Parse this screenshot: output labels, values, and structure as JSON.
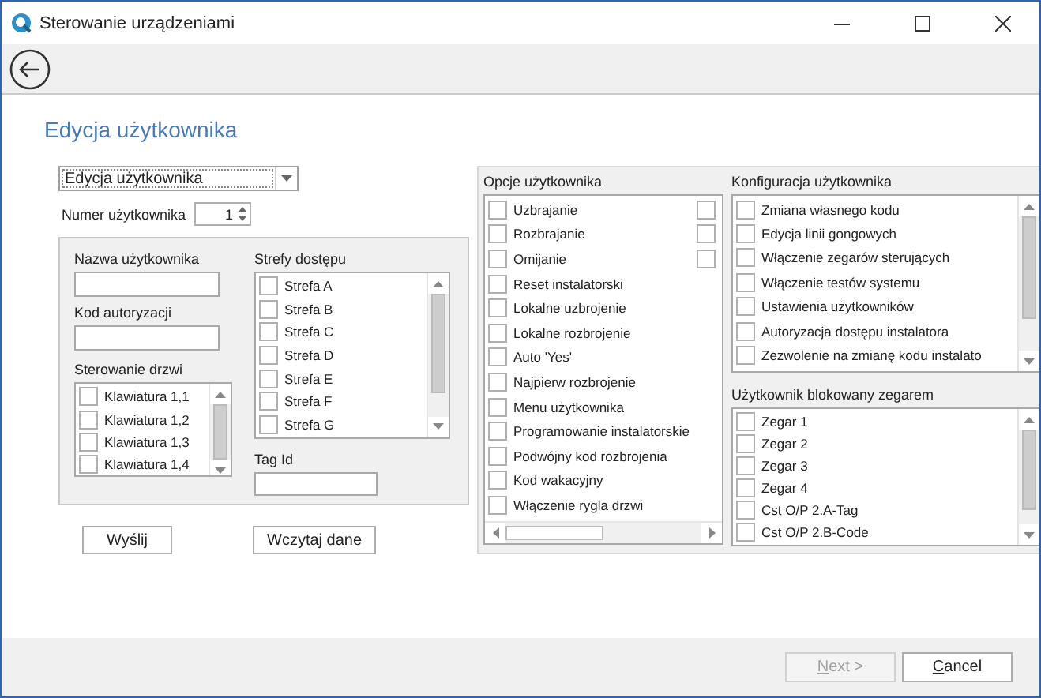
{
  "window": {
    "title": "Sterowanie urządzeniami"
  },
  "page_title": "Edycja użytkownika",
  "mode_dropdown": {
    "value": "Edycja użytkownika"
  },
  "user_number": {
    "label": "Numer użytkownika",
    "value": "1"
  },
  "user_name": {
    "label": "Nazwa użytkownika"
  },
  "auth_code": {
    "label": "Kod autoryzacji"
  },
  "door_control": {
    "label": "Sterowanie drzwi",
    "items": [
      {
        "label": "Klawiatura 1,1",
        "checked": false
      },
      {
        "label": "Klawiatura 1,2",
        "checked": false
      },
      {
        "label": "Klawiatura 1,3",
        "checked": false
      },
      {
        "label": "Klawiatura 1,4",
        "checked": false
      }
    ]
  },
  "access_zones": {
    "label": "Strefy dostępu",
    "items": [
      {
        "label": "Strefa A",
        "checked": false
      },
      {
        "label": "Strefa B",
        "checked": false
      },
      {
        "label": "Strefa C",
        "checked": false
      },
      {
        "label": "Strefa D",
        "checked": false
      },
      {
        "label": "Strefa E",
        "checked": false
      },
      {
        "label": "Strefa F",
        "checked": false
      },
      {
        "label": "Strefa G",
        "checked": false
      }
    ]
  },
  "tag_id": {
    "label": "Tag Id"
  },
  "buttons": [
    {
      "label": "Wyślij"
    },
    {
      "label": "Wczytaj dane"
    }
  ],
  "user_options": {
    "label": "Opcje użytkownika",
    "items": [
      {
        "kind": "pair",
        "label": "Uzbrajanie",
        "checked": false,
        "checked_2": false
      },
      {
        "kind": "pair",
        "label": "Rozbrajanie",
        "checked": false,
        "checked_2": false
      },
      {
        "kind": "pair",
        "label": "Omijanie",
        "checked": false,
        "checked_2": false
      },
      {
        "kind": "single",
        "label": "Reset instalatorski",
        "checked": false
      },
      {
        "kind": "single",
        "label": "Lokalne uzbrojenie",
        "checked": false
      },
      {
        "kind": "single",
        "label": "Lokalne rozbrojenie",
        "checked": false
      },
      {
        "kind": "single",
        "label": "Auto 'Yes'",
        "checked": false
      },
      {
        "kind": "single",
        "label": "Najpierw rozbrojenie",
        "checked": false
      },
      {
        "kind": "single",
        "label": "Menu użytkownika",
        "checked": false
      },
      {
        "kind": "single",
        "label": "Programowanie instalatorskie",
        "checked": false
      },
      {
        "kind": "single",
        "label": "Podwójny kod rozbrojenia",
        "checked": false
      },
      {
        "kind": "single",
        "label": "Kod wakacyjny",
        "checked": false
      },
      {
        "kind": "single",
        "label": "Włączenie rygla drzwi",
        "checked": false
      }
    ]
  },
  "user_config": {
    "label": "Konfiguracja użytkownika",
    "items": [
      {
        "label": "Zmiana własnego kodu",
        "checked": false
      },
      {
        "label": "Edycja linii gongowych",
        "checked": false
      },
      {
        "label": "Włączenie zegarów sterujących",
        "checked": false
      },
      {
        "label": "Włączenie testów systemu",
        "checked": false
      },
      {
        "label": "Ustawienia użytkowników",
        "checked": false
      },
      {
        "label": "Autoryzacja dostępu instalatora",
        "checked": false
      },
      {
        "label": "Zezwolenie na zmianę kodu instalato",
        "checked": false
      }
    ]
  },
  "timer_blocked": {
    "label": "Użytkownik blokowany zegarem",
    "items": [
      {
        "label": "Zegar 1",
        "checked": false
      },
      {
        "label": "Zegar 2",
        "checked": false
      },
      {
        "label": "Zegar 3",
        "checked": false
      },
      {
        "label": "Zegar 4",
        "checked": false
      },
      {
        "label": "Cst O/P 2.A-Tag",
        "checked": false
      },
      {
        "label": "Cst O/P 2.B-Code",
        "checked": false
      }
    ]
  },
  "footer_buttons": [
    {
      "label": "Next >",
      "disabled": true
    },
    {
      "label": "Cancel",
      "disabled": false
    }
  ]
}
